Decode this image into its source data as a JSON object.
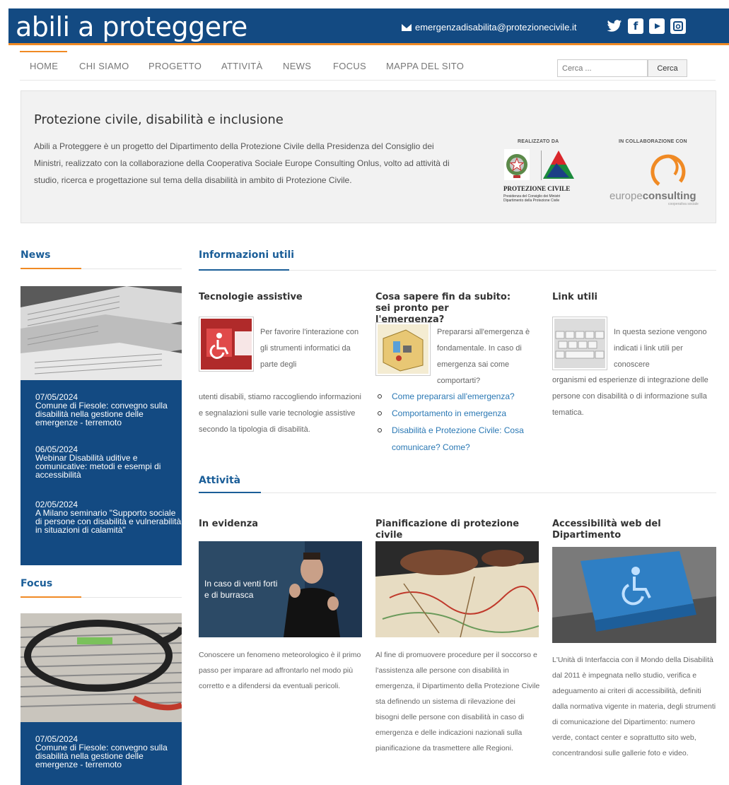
{
  "header": {
    "logo": "abili a proteggere",
    "email": "emergenzadisabilita@protezionecivile.it",
    "social": [
      "twitter-icon",
      "facebook-icon",
      "youtube-icon",
      "instagram-icon"
    ]
  },
  "nav": {
    "items": [
      "HOME",
      "CHI SIAMO",
      "PROGETTO",
      "ATTIVITÀ",
      "NEWS",
      "FOCUS",
      "MAPPA DEL SITO"
    ],
    "search_placeholder": "Cerca ...",
    "search_button": "Cerca"
  },
  "intro": {
    "title": "Protezione civile, disabilità e inclusione",
    "text": "Abili a Proteggere è un progetto del Dipartimento della Protezione Civile della Presidenza del Consiglio dei Ministri, realizzato con la collaborazione della Cooperativa Sociale Europe Consulting Onlus, volto ad attività di studio, ricerca e progettazione sul tema della disabilità in ambito di Protezione Civile.",
    "realizzato_label": "REALIZZATO DA",
    "collab_label": "IN COLLABORAZIONE CON",
    "pc_name": "PROTEZIONE CIVILE",
    "pc_sub": "Presidenza del Consiglio dei Ministri Dipartimento della Protezione Civile",
    "ec_name_a": "europe",
    "ec_name_b": "consulting",
    "ec_sub": "cooperativa sociale"
  },
  "news": {
    "title": "News",
    "items": [
      {
        "date": "07/05/2024",
        "text": "Comune di Fiesole: convegno sulla disabilità nella gestione delle emergenze - terremoto"
      },
      {
        "date": "06/05/2024",
        "text": "Webinar Disabilità uditive e comunicative: metodi e esempi di accessibilità"
      },
      {
        "date": "02/05/2024",
        "text": "A Milano seminario \"Supporto sociale di persone con disabilità e vulnerabilità in situazioni di calamità\""
      }
    ]
  },
  "focus": {
    "title": "Focus",
    "items": [
      {
        "date": "07/05/2024",
        "text": "Comune di Fiesole: convegno sulla disabilità nella gestione delle emergenze - terremoto"
      }
    ]
  },
  "info": {
    "title": "Informazioni utili",
    "col1": {
      "title": "Tecnologie assistive",
      "text_wrap": "Per favorire l'interazione con gli strumenti informatici da parte degli",
      "text_rest": "utenti disabili, stiamo raccogliendo informazioni e segnalazioni sulle varie tecnologie assistive secondo la tipologia di disabilità."
    },
    "col2": {
      "title": "Cosa sapere fin da subito: sei pronto per l'emergenza?",
      "text": "Prepararsi all'emergenza è fondamentale. In caso di emergenza sai come comportarti?",
      "links": [
        "Come prepararsi all'emergenza?",
        "Comportamento in emergenza",
        "Disabilità e Protezione Civile: Cosa comunicare? Come?"
      ]
    },
    "col3": {
      "title": "Link utili",
      "text_wrap": "In questa sezione vengono indicati i link utili per conoscere",
      "text_rest": "organismi ed esperienze di integrazione delle persone con disabilità o di informazione sulla tematica."
    }
  },
  "attivita": {
    "title": "Attività",
    "col1": {
      "title": "In evidenza",
      "overlay": "In caso di venti forti e di burrasca",
      "text": "Conoscere un fenomeno meteorologico è il primo passo per imparare ad affrontarlo nel modo più corretto e a difendersi da eventuali pericoli."
    },
    "col2": {
      "title": "Pianificazione di protezione civile",
      "text": "Al fine di promuovere procedure per il soccorso e l'assistenza alle persone con disabilità in emergenza, il Dipartimento della Protezione Civile sta definendo un sistema di rilevazione dei bisogni delle persone con disabilità in caso di emergenza e delle indicazioni nazionali sulla pianificazione da trasmettere alle Regioni."
    },
    "col3": {
      "title": "Accessibilità web del Dipartimento",
      "text": "L'Unità di Interfaccia con il Mondo della Disabilità dal 2011 è impegnata nello studio, verifica e adeguamento ai criteri di accessibilità, definiti dalla normativa vigente in materia, degli strumenti di comunicazione del Dipartimento: numero verde, contact center e soprattutto sito web, concentrandosi sulle gallerie foto e video."
    }
  },
  "colors": {
    "header": "#134a82",
    "accent": "#f08a24",
    "section_title": "#1b5e98",
    "link": "#2a78b4"
  }
}
